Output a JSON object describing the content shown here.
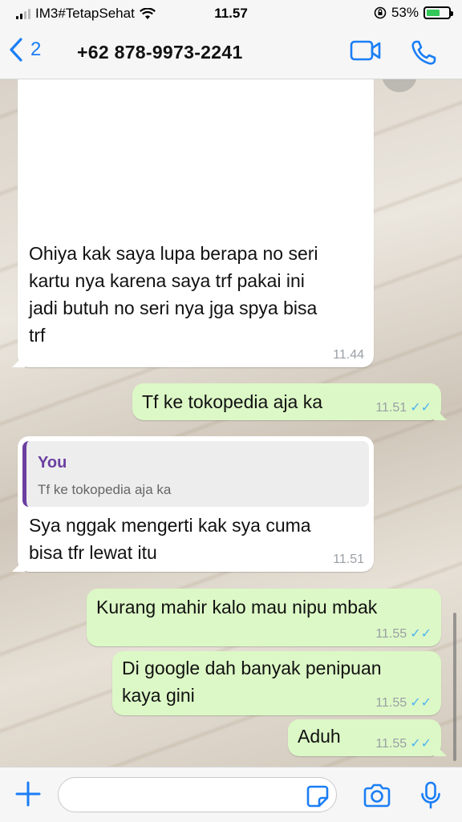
{
  "status_bar": {
    "carrier": "IM3#TetapSehat",
    "time": "11.57",
    "battery": "53%",
    "icons": [
      "signal-icon",
      "wifi-icon",
      "orientation-lock-icon",
      "battery-icon"
    ]
  },
  "header": {
    "back_count": "2",
    "contact": "+62 878-9973-2241",
    "icons": [
      "back-chevron-icon",
      "video-call-icon",
      "phone-icon"
    ],
    "accent_color": "#1a7ef5"
  },
  "messages": [
    {
      "direction": "incoming",
      "lines": [
        "Ohiya kak saya lupa berapa no seri",
        "kartu nya karena saya trf pakai ini",
        "jadi butuh no seri nya jga spya bisa",
        "trf"
      ],
      "time": "11.44"
    },
    {
      "direction": "outgoing",
      "lines": [
        "Tf ke tokopedia aja ka"
      ],
      "time": "11.51",
      "ticks": "✓✓"
    },
    {
      "direction": "incoming",
      "quote": {
        "author": "You",
        "text": "Tf ke tokopedia aja ka"
      },
      "lines": [
        "Sya nggak mengerti kak sya cuma",
        "bisa tfr lewat itu"
      ],
      "time": "11.51"
    },
    {
      "direction": "outgoing",
      "lines": [
        "Kurang mahir kalo mau nipu mbak"
      ],
      "time": "11.55",
      "ticks": "✓✓"
    },
    {
      "direction": "outgoing",
      "lines": [
        "Di google dah banyak penipuan",
        "kaya gini"
      ],
      "time": "11.55",
      "ticks": "✓✓"
    },
    {
      "direction": "outgoing",
      "lines": [
        "Aduh"
      ],
      "time": "11.55",
      "ticks": "✓✓"
    }
  ],
  "input_bar": {
    "placeholder": "",
    "icons": [
      "plus-icon",
      "sticker-icon",
      "camera-icon",
      "microphone-icon"
    ]
  },
  "colors": {
    "outgoing_bubble": "#dcf8c6",
    "incoming_bubble": "#ffffff",
    "read_ticks": "#4fb4f0",
    "quote_author": "#6b3fa0"
  }
}
